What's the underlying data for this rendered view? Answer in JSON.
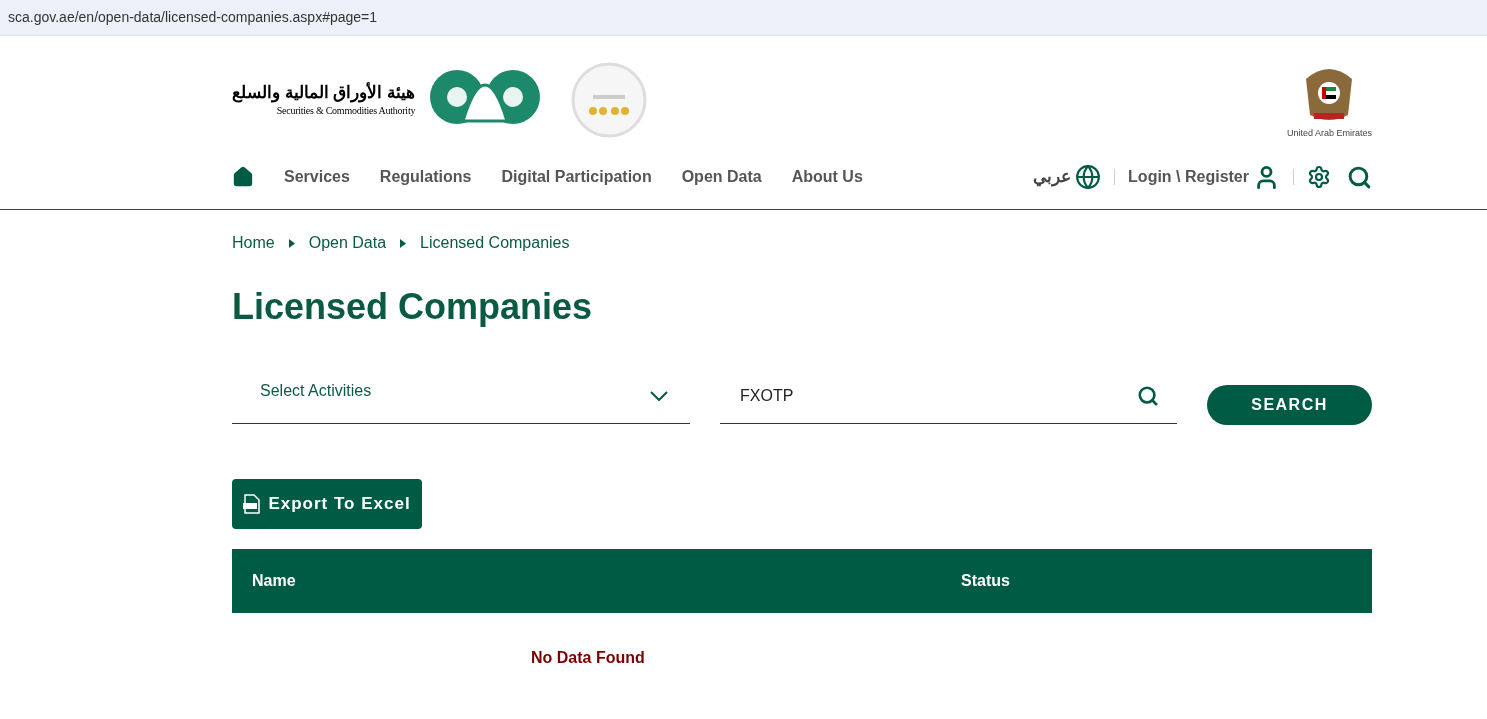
{
  "address_bar": {
    "url": "sca.gov.ae/en/open-data/licensed-companies.aspx#page=1"
  },
  "header": {
    "logo_arabic": "هيئة الأوراق المالية والسلع",
    "logo_english": "Securities & Commodities Authority",
    "emblem_caption": "United Arab Emirates"
  },
  "nav": {
    "items": [
      {
        "label": "Services"
      },
      {
        "label": "Regulations"
      },
      {
        "label": "Digital Participation"
      },
      {
        "label": "Open Data"
      },
      {
        "label": "About Us"
      }
    ],
    "language": "عربي",
    "login": "Login \\ Register"
  },
  "breadcrumb": [
    {
      "label": "Home"
    },
    {
      "label": "Open Data"
    },
    {
      "label": "Licensed Companies"
    }
  ],
  "title": "Licensed Companies",
  "filters": {
    "activity_placeholder": "Select Activities",
    "search_value": "FXOTP",
    "search_button": "SEARCH"
  },
  "export_button": "Export To Excel",
  "table": {
    "columns": [
      "Name",
      "Status"
    ],
    "empty_message": "No Data Found"
  }
}
